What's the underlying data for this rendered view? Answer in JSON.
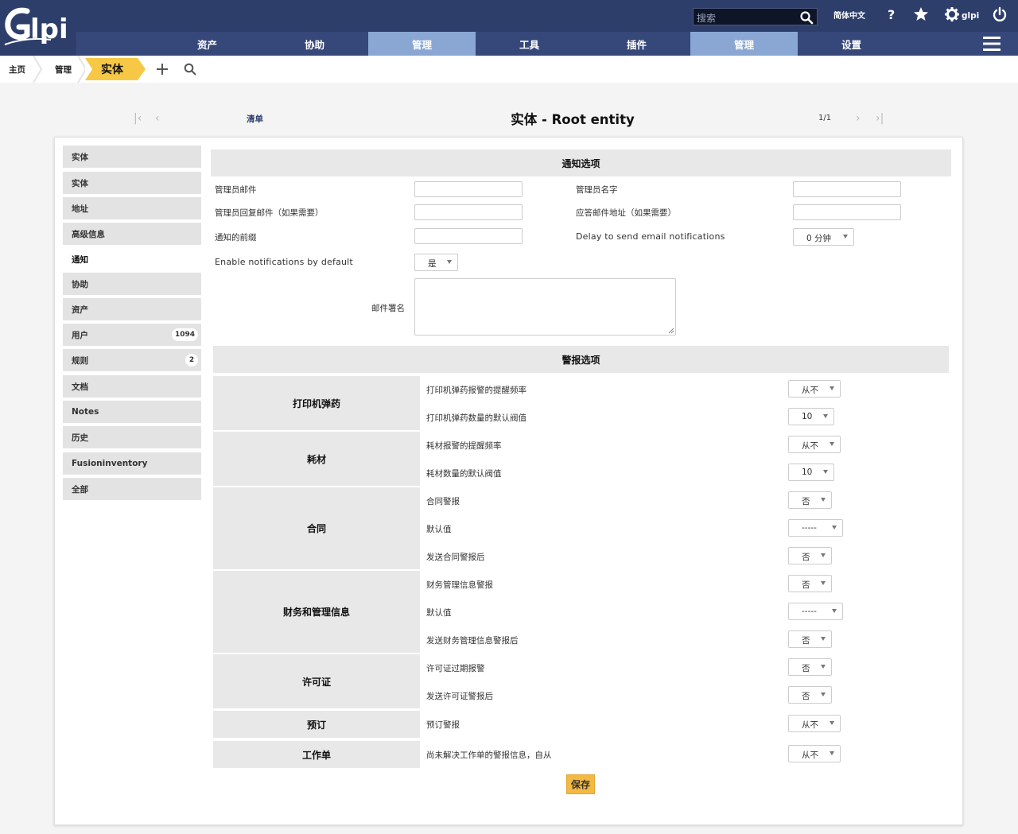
{
  "header": {
    "search_placeholder": "搜索",
    "language": "简体中文",
    "username": "glpi",
    "colors": {
      "header_bg": "#2e3e6b",
      "menu_bg": "#36477a",
      "menu_active": "#8aa7d4",
      "accent": "#f7c845"
    }
  },
  "menu": {
    "items": [
      {
        "label": "资产",
        "active": false
      },
      {
        "label": "协助",
        "active": false
      },
      {
        "label": "管理",
        "active": true
      },
      {
        "label": "工具",
        "active": false
      },
      {
        "label": "插件",
        "active": false
      },
      {
        "label": "管理",
        "active": true
      },
      {
        "label": "设置",
        "active": false
      }
    ]
  },
  "breadcrumb": {
    "home": "主页",
    "admin": "管理",
    "current": "实体"
  },
  "nav": {
    "list_label": "清单",
    "title": "实体 - Root entity",
    "counter": "1/1"
  },
  "tabs": [
    {
      "label": "实体",
      "badge": ""
    },
    {
      "label": "实体",
      "badge": ""
    },
    {
      "label": "地址",
      "badge": ""
    },
    {
      "label": "高级信息",
      "badge": ""
    },
    {
      "label": "通知",
      "badge": "",
      "active": true
    },
    {
      "label": "协助",
      "badge": ""
    },
    {
      "label": "资产",
      "badge": ""
    },
    {
      "label": "用户",
      "badge": "1094"
    },
    {
      "label": "规则",
      "badge": "2"
    },
    {
      "label": "文档",
      "badge": ""
    },
    {
      "label": "Notes",
      "badge": ""
    },
    {
      "label": "历史",
      "badge": ""
    },
    {
      "label": "Fusioninventory",
      "badge": ""
    },
    {
      "label": "全部",
      "badge": ""
    }
  ],
  "notification_options": {
    "header": "通知选项",
    "admin_email_label": "管理员邮件",
    "admin_name_label": "管理员名字",
    "admin_reply_label": "管理员回复邮件（如果需要）",
    "reply_address_label": "应答邮件地址（如果需要）",
    "prefix_label": "通知的前缀",
    "delay_label": "Delay to send email notifications",
    "delay_value": "0 分钟",
    "enable_default_label": "Enable notifications by default",
    "enable_default_value": "是",
    "signature_label": "邮件署名"
  },
  "alert_options": {
    "header": "警报选项",
    "groups": [
      {
        "name": "打印机弹药",
        "rows": [
          {
            "label": "打印机弹药报警的提醒频率",
            "value": "从不"
          },
          {
            "label": "打印机弹药数量的默认阀值",
            "value": "10"
          }
        ]
      },
      {
        "name": "耗材",
        "rows": [
          {
            "label": "耗材报警的提醒频率",
            "value": "从不"
          },
          {
            "label": "耗材数量的默认阀值",
            "value": "10"
          }
        ]
      },
      {
        "name": "合同",
        "rows": [
          {
            "label": "合同警报",
            "value": "否"
          },
          {
            "label": "默认值",
            "value": "-----"
          },
          {
            "label": "发送合同警报后",
            "value": "否"
          }
        ]
      },
      {
        "name": "财务和管理信息",
        "rows": [
          {
            "label": "财务管理信息警报",
            "value": "否"
          },
          {
            "label": "默认值",
            "value": "-----"
          },
          {
            "label": "发送财务管理信息警报后",
            "value": "否"
          }
        ]
      },
      {
        "name": "许可证",
        "rows": [
          {
            "label": "许可证过期报警",
            "value": "否"
          },
          {
            "label": "发送许可证警报后",
            "value": "否"
          }
        ]
      },
      {
        "name": "预订",
        "rows": [
          {
            "label": "预订警报",
            "value": "从不"
          }
        ]
      },
      {
        "name": "工作单",
        "rows": [
          {
            "label": "尚未解决工作单的警报信息，自从",
            "value": "从不"
          }
        ]
      }
    ]
  },
  "save_label": "保存"
}
